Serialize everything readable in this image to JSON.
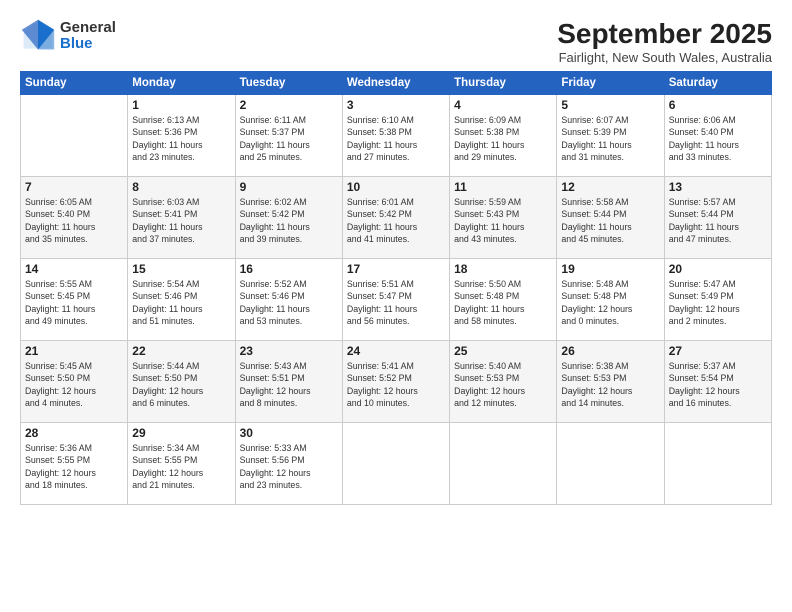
{
  "header": {
    "logo": {
      "general": "General",
      "blue": "Blue"
    },
    "title": "September 2025",
    "subtitle": "Fairlight, New South Wales, Australia"
  },
  "weekdays": [
    "Sunday",
    "Monday",
    "Tuesday",
    "Wednesday",
    "Thursday",
    "Friday",
    "Saturday"
  ],
  "weeks": [
    [
      {
        "day": "",
        "info": ""
      },
      {
        "day": "1",
        "info": "Sunrise: 6:13 AM\nSunset: 5:36 PM\nDaylight: 11 hours\nand 23 minutes."
      },
      {
        "day": "2",
        "info": "Sunrise: 6:11 AM\nSunset: 5:37 PM\nDaylight: 11 hours\nand 25 minutes."
      },
      {
        "day": "3",
        "info": "Sunrise: 6:10 AM\nSunset: 5:38 PM\nDaylight: 11 hours\nand 27 minutes."
      },
      {
        "day": "4",
        "info": "Sunrise: 6:09 AM\nSunset: 5:38 PM\nDaylight: 11 hours\nand 29 minutes."
      },
      {
        "day": "5",
        "info": "Sunrise: 6:07 AM\nSunset: 5:39 PM\nDaylight: 11 hours\nand 31 minutes."
      },
      {
        "day": "6",
        "info": "Sunrise: 6:06 AM\nSunset: 5:40 PM\nDaylight: 11 hours\nand 33 minutes."
      }
    ],
    [
      {
        "day": "7",
        "info": "Sunrise: 6:05 AM\nSunset: 5:40 PM\nDaylight: 11 hours\nand 35 minutes."
      },
      {
        "day": "8",
        "info": "Sunrise: 6:03 AM\nSunset: 5:41 PM\nDaylight: 11 hours\nand 37 minutes."
      },
      {
        "day": "9",
        "info": "Sunrise: 6:02 AM\nSunset: 5:42 PM\nDaylight: 11 hours\nand 39 minutes."
      },
      {
        "day": "10",
        "info": "Sunrise: 6:01 AM\nSunset: 5:42 PM\nDaylight: 11 hours\nand 41 minutes."
      },
      {
        "day": "11",
        "info": "Sunrise: 5:59 AM\nSunset: 5:43 PM\nDaylight: 11 hours\nand 43 minutes."
      },
      {
        "day": "12",
        "info": "Sunrise: 5:58 AM\nSunset: 5:44 PM\nDaylight: 11 hours\nand 45 minutes."
      },
      {
        "day": "13",
        "info": "Sunrise: 5:57 AM\nSunset: 5:44 PM\nDaylight: 11 hours\nand 47 minutes."
      }
    ],
    [
      {
        "day": "14",
        "info": "Sunrise: 5:55 AM\nSunset: 5:45 PM\nDaylight: 11 hours\nand 49 minutes."
      },
      {
        "day": "15",
        "info": "Sunrise: 5:54 AM\nSunset: 5:46 PM\nDaylight: 11 hours\nand 51 minutes."
      },
      {
        "day": "16",
        "info": "Sunrise: 5:52 AM\nSunset: 5:46 PM\nDaylight: 11 hours\nand 53 minutes."
      },
      {
        "day": "17",
        "info": "Sunrise: 5:51 AM\nSunset: 5:47 PM\nDaylight: 11 hours\nand 56 minutes."
      },
      {
        "day": "18",
        "info": "Sunrise: 5:50 AM\nSunset: 5:48 PM\nDaylight: 11 hours\nand 58 minutes."
      },
      {
        "day": "19",
        "info": "Sunrise: 5:48 AM\nSunset: 5:48 PM\nDaylight: 12 hours\nand 0 minutes."
      },
      {
        "day": "20",
        "info": "Sunrise: 5:47 AM\nSunset: 5:49 PM\nDaylight: 12 hours\nand 2 minutes."
      }
    ],
    [
      {
        "day": "21",
        "info": "Sunrise: 5:45 AM\nSunset: 5:50 PM\nDaylight: 12 hours\nand 4 minutes."
      },
      {
        "day": "22",
        "info": "Sunrise: 5:44 AM\nSunset: 5:50 PM\nDaylight: 12 hours\nand 6 minutes."
      },
      {
        "day": "23",
        "info": "Sunrise: 5:43 AM\nSunset: 5:51 PM\nDaylight: 12 hours\nand 8 minutes."
      },
      {
        "day": "24",
        "info": "Sunrise: 5:41 AM\nSunset: 5:52 PM\nDaylight: 12 hours\nand 10 minutes."
      },
      {
        "day": "25",
        "info": "Sunrise: 5:40 AM\nSunset: 5:53 PM\nDaylight: 12 hours\nand 12 minutes."
      },
      {
        "day": "26",
        "info": "Sunrise: 5:38 AM\nSunset: 5:53 PM\nDaylight: 12 hours\nand 14 minutes."
      },
      {
        "day": "27",
        "info": "Sunrise: 5:37 AM\nSunset: 5:54 PM\nDaylight: 12 hours\nand 16 minutes."
      }
    ],
    [
      {
        "day": "28",
        "info": "Sunrise: 5:36 AM\nSunset: 5:55 PM\nDaylight: 12 hours\nand 18 minutes."
      },
      {
        "day": "29",
        "info": "Sunrise: 5:34 AM\nSunset: 5:55 PM\nDaylight: 12 hours\nand 21 minutes."
      },
      {
        "day": "30",
        "info": "Sunrise: 5:33 AM\nSunset: 5:56 PM\nDaylight: 12 hours\nand 23 minutes."
      },
      {
        "day": "",
        "info": ""
      },
      {
        "day": "",
        "info": ""
      },
      {
        "day": "",
        "info": ""
      },
      {
        "day": "",
        "info": ""
      }
    ]
  ]
}
